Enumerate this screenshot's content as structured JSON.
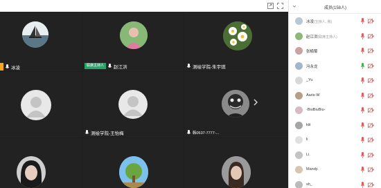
{
  "toolbar": {
    "icons": [
      "screen-share-icon",
      "fullscreen-icon",
      "close-icon"
    ]
  },
  "tiles": [
    {
      "name": "冰凌",
      "avatar": "sailboat-photo",
      "host": false,
      "yellow": true
    },
    {
      "name": "赵江洪",
      "avatar": "person-photo",
      "host": true,
      "host_label": "联席主持人"
    },
    {
      "name": "测绘学院-朱宇琪",
      "avatar": "daisy-photo",
      "host": false
    },
    {
      "name": "",
      "avatar": "placeholder",
      "host": false
    },
    {
      "name": "测绘学院-王怡梅",
      "avatar": "placeholder",
      "host": false
    },
    {
      "name": "韩0537-7777-...",
      "avatar": "mask-photo",
      "host": false
    },
    {
      "name": "",
      "avatar": "girl-photo",
      "host": false
    },
    {
      "name": "",
      "avatar": "tree-photo",
      "host": false
    },
    {
      "name": "",
      "avatar": "person2-photo",
      "host": false
    }
  ],
  "panel": {
    "title": "成员(158人)",
    "members": [
      {
        "name": "冰凌",
        "role": "(主持人, 我)",
        "mic_color": "#e05a5a"
      },
      {
        "name": "赵江洪",
        "role": "(联席主持人)",
        "mic_color": "#e05a5a"
      },
      {
        "name": "张楠萄",
        "role": "",
        "mic_color": "#e05a5a"
      },
      {
        "name": "冯永龙",
        "role": "",
        "mic_color": "#3bb34a"
      },
      {
        "name": "_Yu",
        "role": "",
        "mic_color": "#e05a5a"
      },
      {
        "name": "Aaris-W",
        "role": "",
        "mic_color": "#e05a5a"
      },
      {
        "name": "-BiuBiuBiu-",
        "role": "",
        "mic_color": "#e05a5a"
      },
      {
        "name": "kiii",
        "role": "",
        "mic_color": "#e05a5a"
      },
      {
        "name": "li",
        "role": "",
        "mic_color": "#e05a5a"
      },
      {
        "name": "Li.",
        "role": "",
        "mic_color": "#e05a5a"
      },
      {
        "name": "Mandy.",
        "role": "",
        "mic_color": "#e05a5a"
      },
      {
        "name": "sh_",
        "role": "",
        "mic_color": "#e05a5a"
      }
    ]
  }
}
